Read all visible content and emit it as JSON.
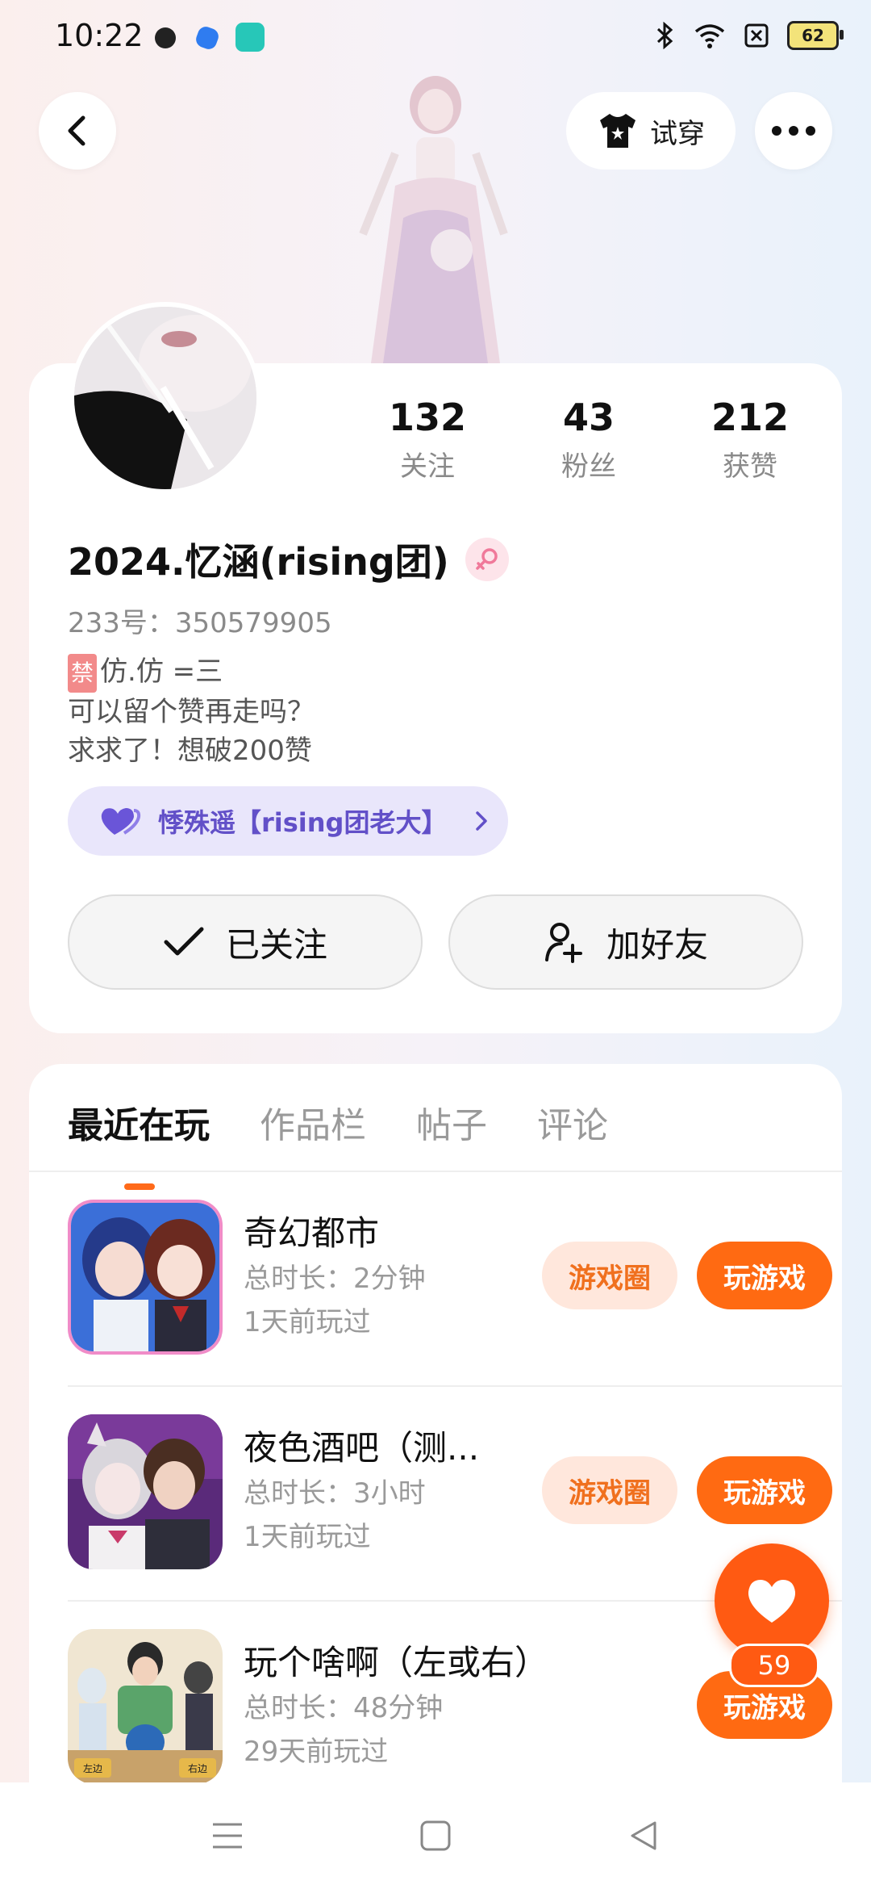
{
  "status": {
    "time": "10:22",
    "battery": "62"
  },
  "header": {
    "try_on_label": "试穿"
  },
  "profile": {
    "stats": [
      {
        "num": "132",
        "label": "关注"
      },
      {
        "num": "43",
        "label": "粉丝"
      },
      {
        "num": "212",
        "label": "获赞"
      }
    ],
    "name": "2024.忆涵(rising团)",
    "uid": "233号：350579905",
    "bio_tag": "禁",
    "bio_line1": "仿.仿 =三",
    "bio_line2": "可以留个赞再走吗？",
    "bio_line3": "求求了！想破200赞",
    "relation": "悸殊遥【rising团老大】",
    "followed_label": "已关注",
    "add_friend_label": "加好友"
  },
  "tabs": [
    "最近在玩",
    "作品栏",
    "帖子",
    "评论"
  ],
  "games": [
    {
      "title": "奇幻都市",
      "duration": "总时长：2分钟",
      "last_played": "1天前玩过",
      "circle": "游戏圈",
      "play": "玩游戏"
    },
    {
      "title": "夜色酒吧（测...",
      "duration": "总时长：3小时",
      "last_played": "1天前玩过",
      "circle": "游戏圈",
      "play": "玩游戏"
    },
    {
      "title": "玩个啥啊（左或右）",
      "duration": "总时长：48分钟",
      "last_played": "29天前玩过",
      "play": "玩游戏",
      "icon_left": "左边",
      "icon_right": "右边"
    }
  ],
  "like_count": "59",
  "colors": {
    "accent": "#ff6a12",
    "accent_soft": "#ffe7dc",
    "badge_purple": "#6250c8"
  }
}
